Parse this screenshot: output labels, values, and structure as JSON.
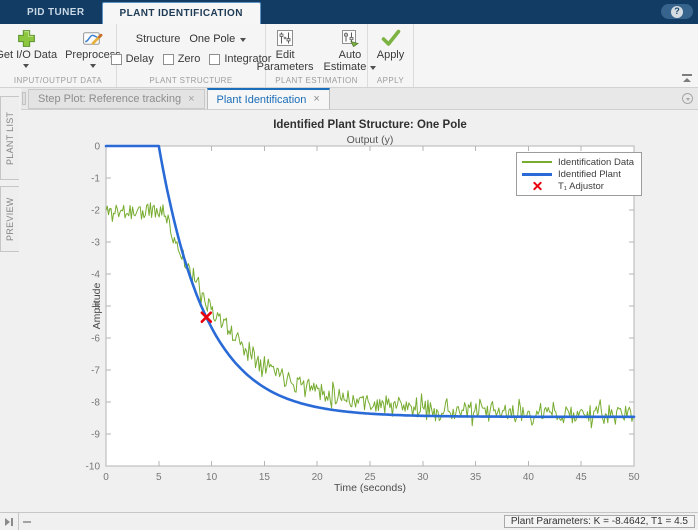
{
  "ribbon": {
    "tabs": [
      {
        "label": "PID TUNER",
        "active": false
      },
      {
        "label": "PLANT IDENTIFICATION",
        "active": true
      }
    ],
    "help_label": "?"
  },
  "toolstrip": {
    "groups": [
      {
        "label": "INPUT/OUTPUT DATA",
        "buttons": [
          {
            "label": "Get I/O Data",
            "icon": "add-data-icon",
            "dropdown": true
          },
          {
            "label": "Preprocess",
            "icon": "preprocess-icon",
            "dropdown": true
          }
        ]
      },
      {
        "label": "PLANT STRUCTURE",
        "structure_label": "Structure",
        "structure_value": "One Pole",
        "checkboxes": [
          {
            "label": "Delay",
            "checked": false
          },
          {
            "label": "Zero",
            "checked": false
          },
          {
            "label": "Integrator",
            "checked": false
          }
        ]
      },
      {
        "label": "PLANT ESTIMATION",
        "buttons": [
          {
            "line1": "Edit",
            "line2": "Parameters",
            "icon": "edit-parameters-icon",
            "dropdown": false
          },
          {
            "line1": "Auto",
            "line2": "Estimate",
            "icon": "auto-estimate-icon",
            "dropdown": true
          }
        ]
      },
      {
        "label": "APPLY",
        "buttons": [
          {
            "label": "Apply",
            "icon": "apply-check-icon"
          }
        ]
      }
    ]
  },
  "sidebar": {
    "tabs": [
      {
        "label": "PLANT LIST"
      },
      {
        "label": "PREVIEW"
      }
    ]
  },
  "doc_tabs": [
    {
      "label": "Step Plot: Reference tracking",
      "close": "×",
      "active": false
    },
    {
      "label": "Plant Identification",
      "close": "×",
      "active": true
    }
  ],
  "statusbar": {
    "plant_parameters": "Plant Parameters: K = -8.4642, T1 = 4.5"
  },
  "chart_data": {
    "type": "line",
    "title": "Identified Plant Structure: One Pole",
    "subtitle": "Output (y)",
    "xlabel": "Time (seconds)",
    "ylabel": "Amplitude",
    "xlim": [
      0,
      50
    ],
    "ylim": [
      -10,
      0
    ],
    "xticks": [
      0,
      5,
      10,
      15,
      20,
      25,
      30,
      35,
      40,
      45,
      50
    ],
    "yticks": [
      0,
      -1,
      -2,
      -3,
      -4,
      -5,
      -6,
      -7,
      -8,
      -9,
      -10
    ],
    "grid": false,
    "legend": {
      "position": "top-right",
      "entries": [
        "Identification Data",
        "Identified Plant",
        "T₁ Adjustor"
      ]
    },
    "series": [
      {
        "name": "Identification Data",
        "type": "noisy-line",
        "color": "#77ac30",
        "line_width": 1,
        "model": "y = start for t<=decay_start; y = final + (start-final)*exp(-(t-decay_start)/tau); plus noise",
        "params": {
          "start": -2.05,
          "final": -8.4,
          "decay_start": 5.5,
          "tau": 7.0,
          "dt": 0.12,
          "noise_amplitude": 1.05,
          "seed": 11
        },
        "keypoints": [
          [
            0,
            -2.1
          ],
          [
            5,
            -2.1
          ],
          [
            10,
            -4.9
          ],
          [
            15,
            -6.8
          ],
          [
            20,
            -7.6
          ],
          [
            25,
            -8.1
          ],
          [
            30,
            -8.3
          ],
          [
            35,
            -8.4
          ],
          [
            40,
            -8.4
          ],
          [
            45,
            -8.4
          ],
          [
            50,
            -8.4
          ]
        ]
      },
      {
        "name": "Identified Plant",
        "type": "line",
        "color": "#2a6ad6",
        "line_width": 2.6,
        "model": "y = 0 for t<delay; y = K*(1-exp(-(t-delay)/T1)) for t>=delay",
        "params": {
          "K": -8.4642,
          "T1": 4.5,
          "delay": 5
        }
      },
      {
        "name": "T1 Adjustor",
        "type": "marker",
        "marker": "x",
        "color": "#e8000d",
        "point": [
          9.5,
          -5.35
        ]
      }
    ]
  }
}
